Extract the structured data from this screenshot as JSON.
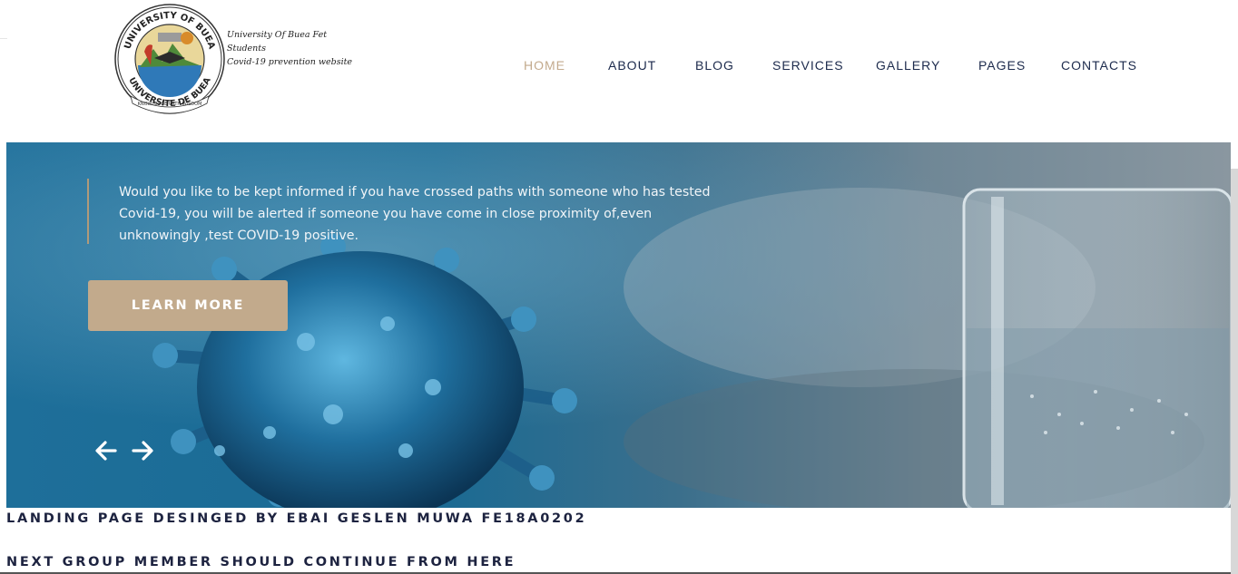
{
  "brand": {
    "seal_text_top": "UNIVERSITY OF BUEA",
    "seal_text_bottom": "UNIVERSITE DE BUEA",
    "seal_motto": "KNOWLEDGE WITH WISDOM",
    "caption_line1": "University Of Buea Fet Students",
    "caption_line2": "Covid-19 prevention website"
  },
  "nav": {
    "items": [
      {
        "label": "HOME",
        "active": true
      },
      {
        "label": "ABOUT",
        "active": false
      },
      {
        "label": "BLOG",
        "active": false
      },
      {
        "label": "SERVICES",
        "active": false
      },
      {
        "label": "GALLERY",
        "active": false
      },
      {
        "label": "PAGES",
        "active": false
      },
      {
        "label": "CONTACTS",
        "active": false
      }
    ],
    "active_color": "#c3aa8d",
    "link_color": "#1c2a4c"
  },
  "hero": {
    "text": "Would you like to be kept informed if you have crossed paths with someone who has tested Covid-19, you will be alerted if someone you have come in close proximity of,even unknowingly ,test COVID-19 positive.",
    "button_label": "LEARN MORE",
    "button_color": "#c2aa8c",
    "prev_icon": "arrow-left-icon",
    "next_icon": "arrow-right-icon"
  },
  "footer": {
    "credit_line": "LANDING PAGE DESINGED BY EBAI GESLEN MUWA FE18A0202",
    "next_line": "NEXT GROUP MEMBER SHOULD CONTINUE FROM HERE"
  }
}
